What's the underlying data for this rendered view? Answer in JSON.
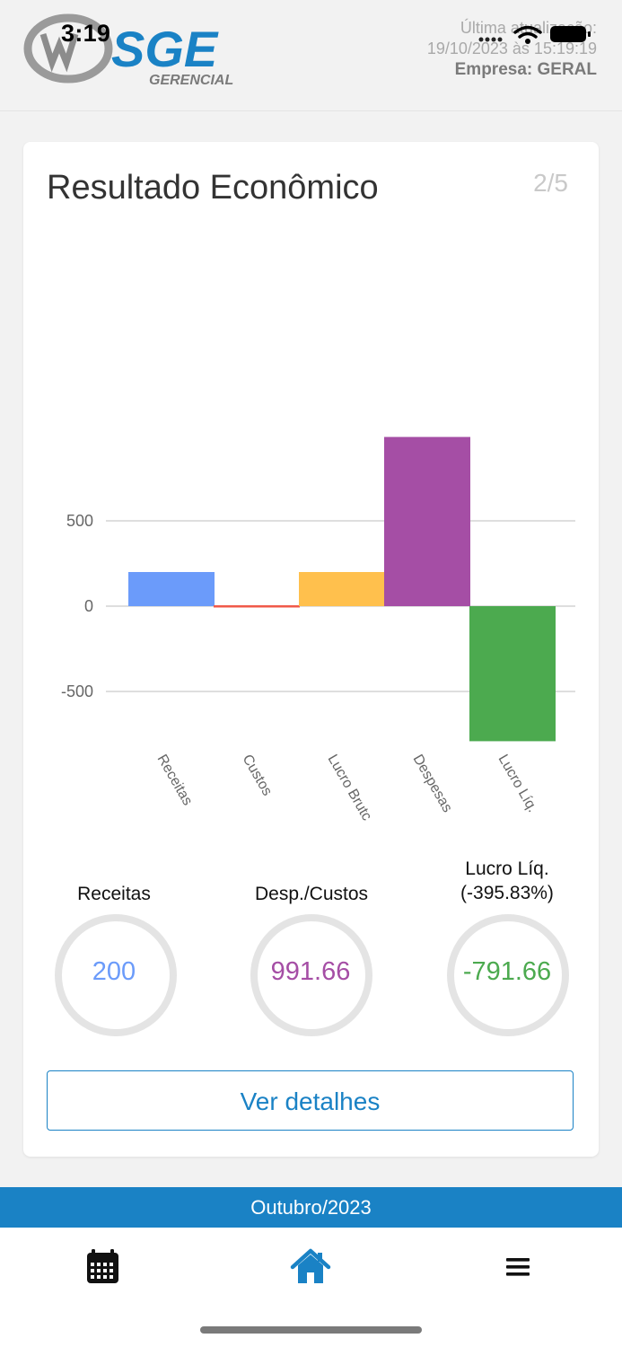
{
  "status_bar": {
    "time": "3:19"
  },
  "header": {
    "logo": {
      "brand": "SGE",
      "subtitle": "GERENCIAL"
    },
    "update_label": "Última atualização:",
    "update_date": "19/10/2023 às 15:19:19",
    "company": "Empresa: GERAL"
  },
  "card": {
    "title": "Resultado Econômico",
    "pager": "2/5",
    "details_button": "Ver detalhes"
  },
  "chart_data": {
    "type": "bar",
    "categories": [
      "Receitas",
      "Custos",
      "Lucro Brutc",
      "Despesas",
      "Lucro Líq."
    ],
    "values": [
      200,
      0,
      200,
      991.66,
      -791.66
    ],
    "colors": [
      "#6b9bfa",
      "#f05a4a",
      "#ffc04d",
      "#a54ea5",
      "#4caa4f"
    ],
    "yticks": [
      "500",
      "0",
      "-500"
    ],
    "ylim": [
      -791.66,
      991.66
    ],
    "grid": true
  },
  "metrics": [
    {
      "label": "Receitas",
      "value": "200",
      "color": "#6b9bfa"
    },
    {
      "label": "Desp./Custos",
      "value": "991.66",
      "color": "#a54ea5"
    },
    {
      "label": "Lucro Líq.",
      "label2": "(-395.83%)",
      "value": "-791.66",
      "color": "#4caa4f"
    }
  ],
  "footer": {
    "month": "Outubro/2023"
  },
  "tabs": [
    {
      "name": "calendar-icon"
    },
    {
      "name": "home-icon",
      "color": "#1a82c5"
    },
    {
      "name": "menu-icon"
    }
  ]
}
